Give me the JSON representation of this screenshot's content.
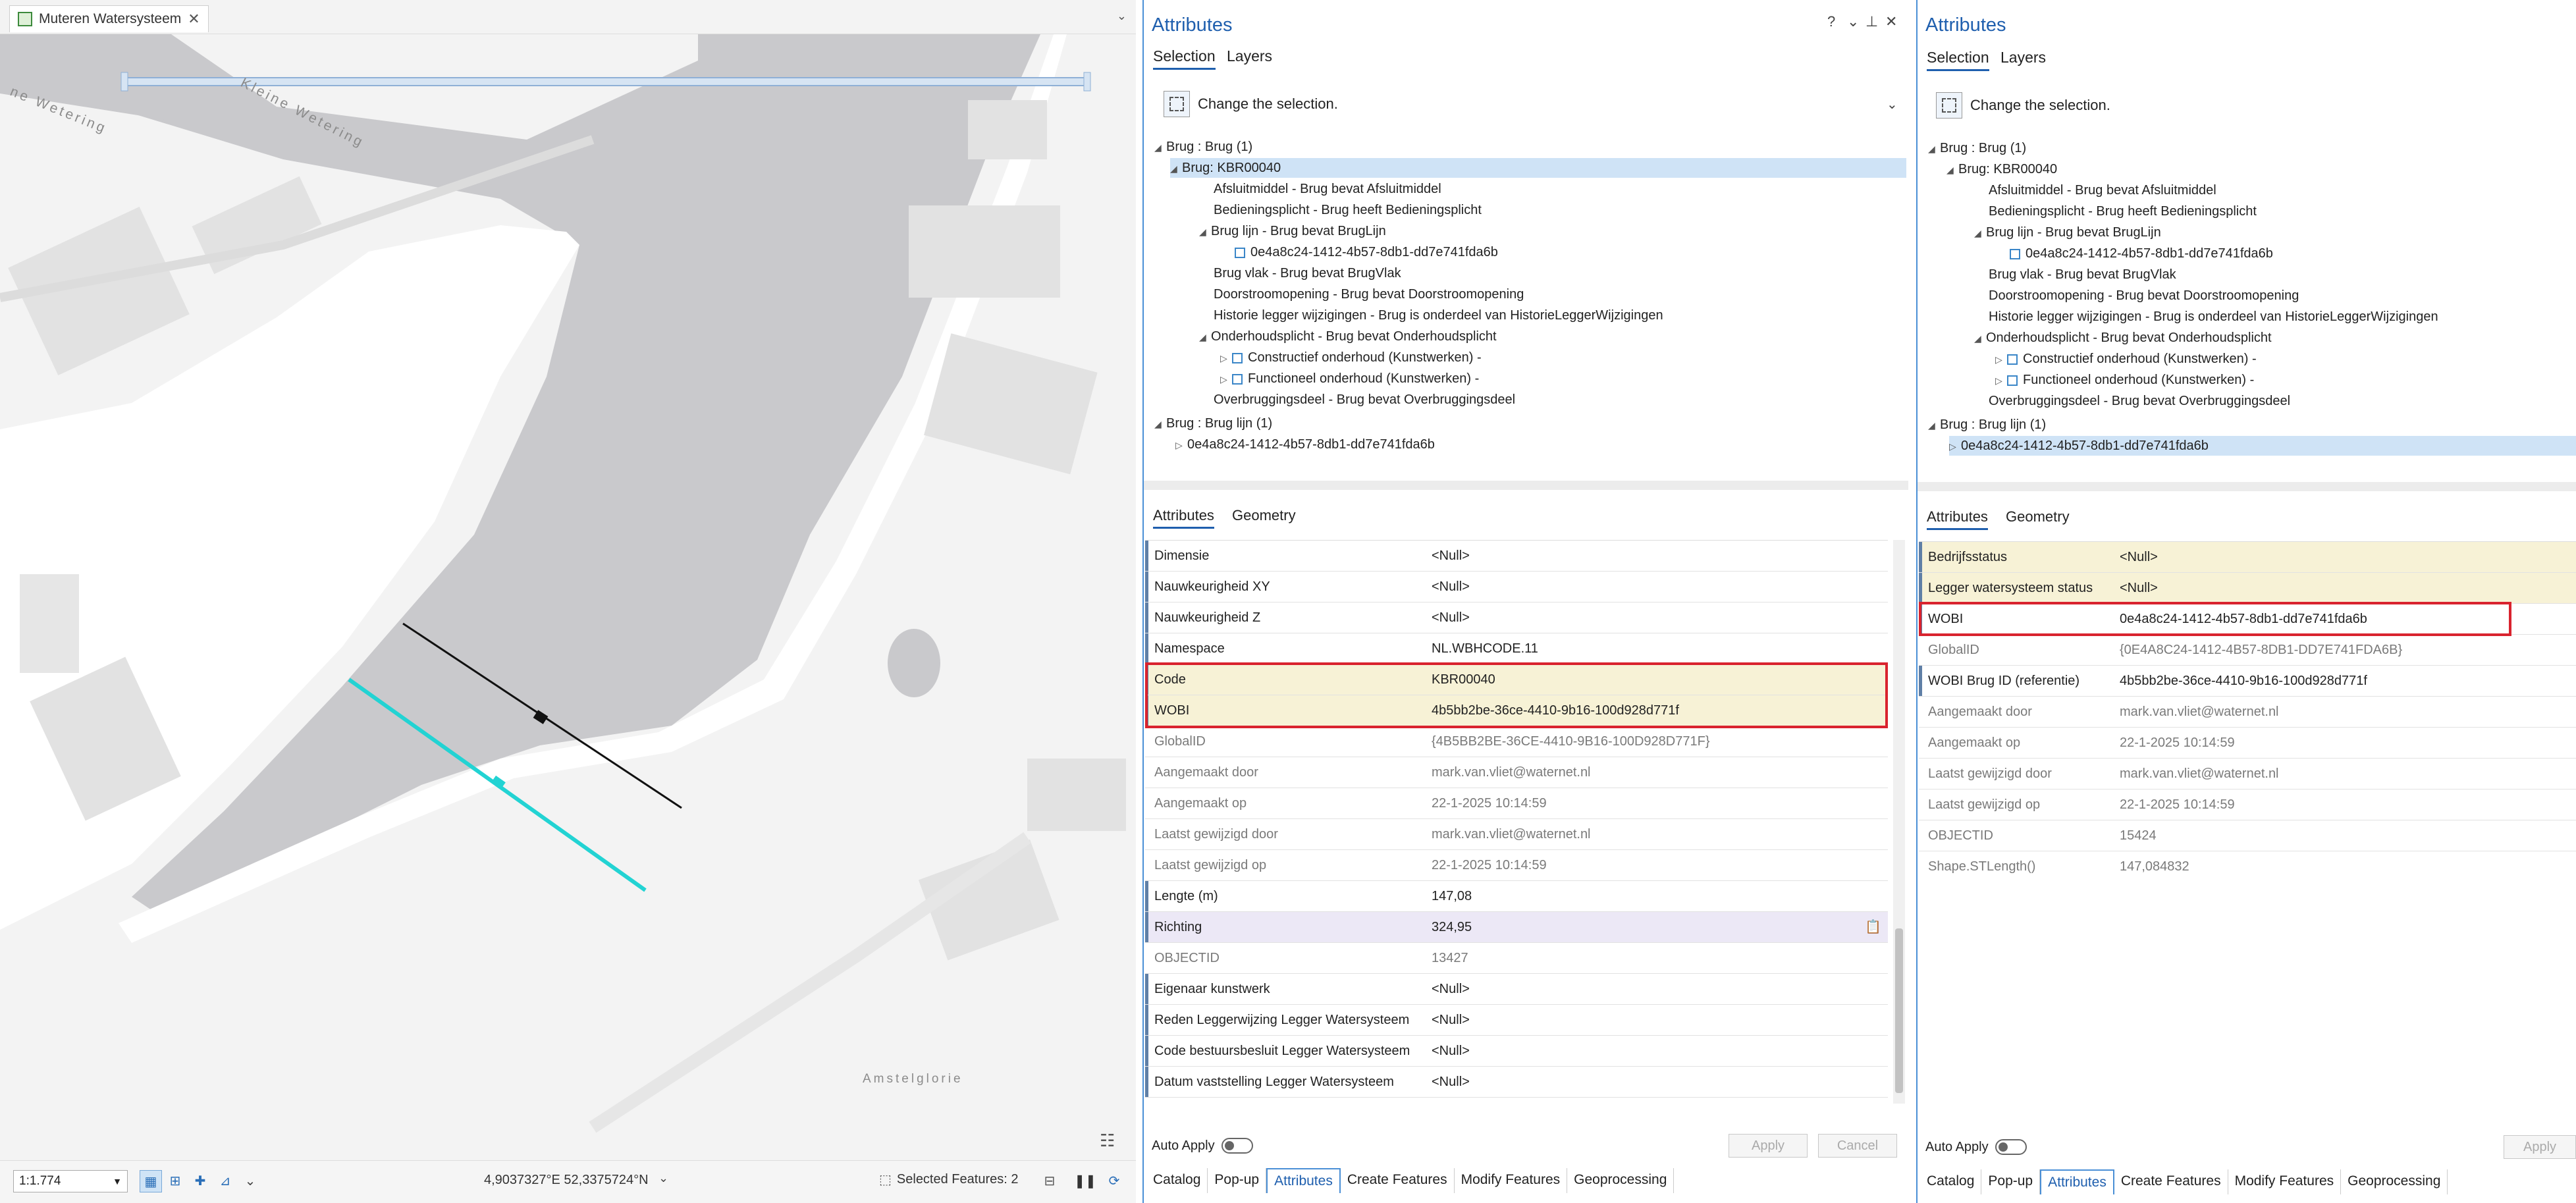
{
  "map": {
    "tab_title": "Muteren Watersysteem",
    "labels": {
      "kleine_weteringm": "Kleine Wetering",
      "ne_wetering": "ne Wetering",
      "amstelglorie": "Amstelglorie"
    },
    "status": {
      "scale": "1:1.774",
      "coordinates": "4,9037327°E 52,3375724°N",
      "selected_features": "Selected Features: 2"
    }
  },
  "pane1": {
    "title": "Attributes",
    "controls": {
      "help": "?",
      "menu": "⌄",
      "pin": "⊥",
      "close": "✕"
    },
    "tabs": [
      "Selection",
      "Layers"
    ],
    "change_selection": "Change the selection.",
    "tree": [
      "Brug : Brug (1)",
      "Brug: KBR00040",
      "Afsluitmiddel - Brug bevat Afsluitmiddel",
      "Bedieningsplicht - Brug heeft Bedieningsplicht",
      "Brug lijn - Brug bevat BrugLijn",
      "0e4a8c24-1412-4b57-8db1-dd7e741fda6b",
      "Brug vlak - Brug bevat BrugVlak",
      "Doorstroomopening - Brug bevat Doorstroomopening",
      "Historie legger wijzigingen - Brug is onderdeel van HistorieLeggerWijzigingen",
      "Onderhoudsplicht - Brug bevat Onderhoudsplicht",
      "Constructief onderhoud (Kunstwerken) -",
      "Functioneel onderhoud (Kunstwerken) -",
      "Overbruggingsdeel - Brug bevat Overbruggingsdeel",
      "Brug : Brug lijn (1)",
      "0e4a8c24-1412-4b57-8db1-dd7e741fda6b"
    ],
    "attr_tabs": [
      "Attributes",
      "Geometry"
    ],
    "rows": [
      {
        "name": "Dimensie",
        "value": "<Null>"
      },
      {
        "name": "Nauwkeurigheid XY",
        "value": "<Null>"
      },
      {
        "name": "Nauwkeurigheid Z",
        "value": "<Null>"
      },
      {
        "name": "Namespace",
        "value": "NL.WBHCODE.11"
      },
      {
        "name": "Code",
        "value": "KBR00040"
      },
      {
        "name": "WOBI",
        "value": "4b5bb2be-36ce-4410-9b16-100d928d771f"
      },
      {
        "name": "GlobalID",
        "value": "{4B5BB2BE-36CE-4410-9B16-100D928D771F}"
      },
      {
        "name": "Aangemaakt door",
        "value": "mark.van.vliet@waternet.nl"
      },
      {
        "name": "Aangemaakt op",
        "value": "22-1-2025 10:14:59"
      },
      {
        "name": "Laatst gewijzigd door",
        "value": "mark.van.vliet@waternet.nl"
      },
      {
        "name": "Laatst gewijzigd op",
        "value": "22-1-2025 10:14:59"
      },
      {
        "name": "Lengte (m)",
        "value": "147,08"
      },
      {
        "name": "Richting",
        "value": "324,95"
      },
      {
        "name": "OBJECTID",
        "value": "13427"
      },
      {
        "name": "Eigenaar kunstwerk",
        "value": "<Null>"
      },
      {
        "name": "Reden Leggerwijzing Legger Watersysteem",
        "value": "<Null>"
      },
      {
        "name": "Code bestuursbesluit Legger Watersysteem",
        "value": "<Null>"
      },
      {
        "name": "Datum vaststelling Legger Watersysteem",
        "value": "<Null>"
      }
    ],
    "auto_apply": "Auto Apply",
    "apply": "Apply",
    "cancel": "Cancel",
    "dock_tabs": [
      "Catalog",
      "Pop-up",
      "Attributes",
      "Create Features",
      "Modify Features",
      "Geoprocessing"
    ]
  },
  "pane2": {
    "title": "Attributes",
    "tabs": [
      "Selection",
      "Layers"
    ],
    "change_selection": "Change the selection.",
    "tree": [
      "Brug : Brug (1)",
      "Brug: KBR00040",
      "Afsluitmiddel - Brug bevat Afsluitmiddel",
      "Bedieningsplicht - Brug heeft Bedieningsplicht",
      "Brug lijn - Brug bevat BrugLijn",
      "0e4a8c24-1412-4b57-8db1-dd7e741fda6b",
      "Brug vlak - Brug bevat BrugVlak",
      "Doorstroomopening - Brug bevat Doorstroomopening",
      "Historie legger wijzigingen - Brug is onderdeel van HistorieLeggerWijzigingen",
      "Onderhoudsplicht - Brug bevat Onderhoudsplicht",
      "Constructief onderhoud (Kunstwerken) -",
      "Functioneel onderhoud (Kunstwerken) -",
      "Overbruggingsdeel - Brug bevat Overbruggingsdeel",
      "Brug : Brug lijn (1)",
      "0e4a8c24-1412-4b57-8db1-dd7e741fda6b"
    ],
    "attr_tabs": [
      "Attributes",
      "Geometry"
    ],
    "rows": [
      {
        "name": "Bedrijfsstatus",
        "value": "<Null>"
      },
      {
        "name": "Legger watersysteem status",
        "value": "<Null>"
      },
      {
        "name": "WOBI",
        "value": "0e4a8c24-1412-4b57-8db1-dd7e741fda6b"
      },
      {
        "name": "GlobalID",
        "value": "{0E4A8C24-1412-4B57-8DB1-DD7E741FDA6B}"
      },
      {
        "name": "WOBI Brug ID (referentie)",
        "value": "4b5bb2be-36ce-4410-9b16-100d928d771f"
      },
      {
        "name": "Aangemaakt door",
        "value": "mark.van.vliet@waternet.nl"
      },
      {
        "name": "Aangemaakt op",
        "value": "22-1-2025 10:14:59"
      },
      {
        "name": "Laatst gewijzigd door",
        "value": "mark.van.vliet@waternet.nl"
      },
      {
        "name": "Laatst gewijzigd op",
        "value": "22-1-2025 10:14:59"
      },
      {
        "name": "OBJECTID",
        "value": "15424"
      },
      {
        "name": "Shape.STLength()",
        "value": "147,084832"
      }
    ],
    "auto_apply": "Auto Apply",
    "apply": "Apply",
    "dock_tabs": [
      "Catalog",
      "Pop-up",
      "Attributes",
      "Create Features",
      "Modify Features",
      "Geoprocessing"
    ]
  }
}
